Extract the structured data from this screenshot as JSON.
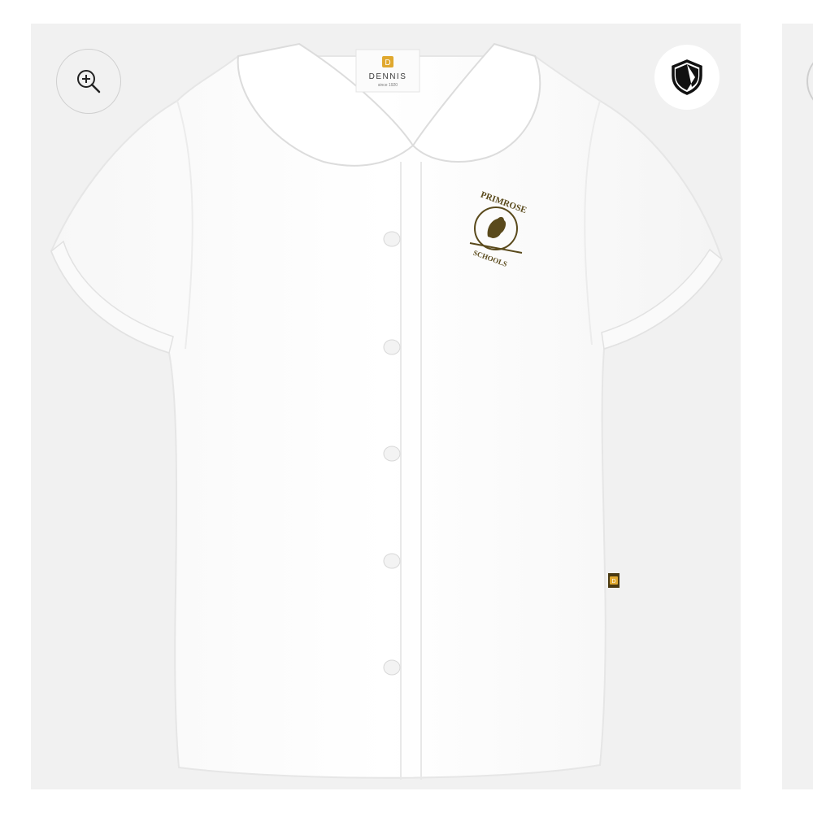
{
  "gallery": {
    "zoom_icon": "zoom-in-icon",
    "badge_icon": "shield-icon",
    "product_image": {
      "tag_brand": "DENNIS",
      "tag_since": "since 1920",
      "tag_logo_letter": "D",
      "emblem_top": "PRIMROSE",
      "emblem_bottom": "SCHOOLS",
      "side_tag_letter": "D"
    }
  },
  "colors": {
    "frame_bg": "#f1f1f1",
    "shirt_white": "#ffffff",
    "embroidery": "#5a4a1c",
    "tag_gold": "#e0a82e"
  }
}
